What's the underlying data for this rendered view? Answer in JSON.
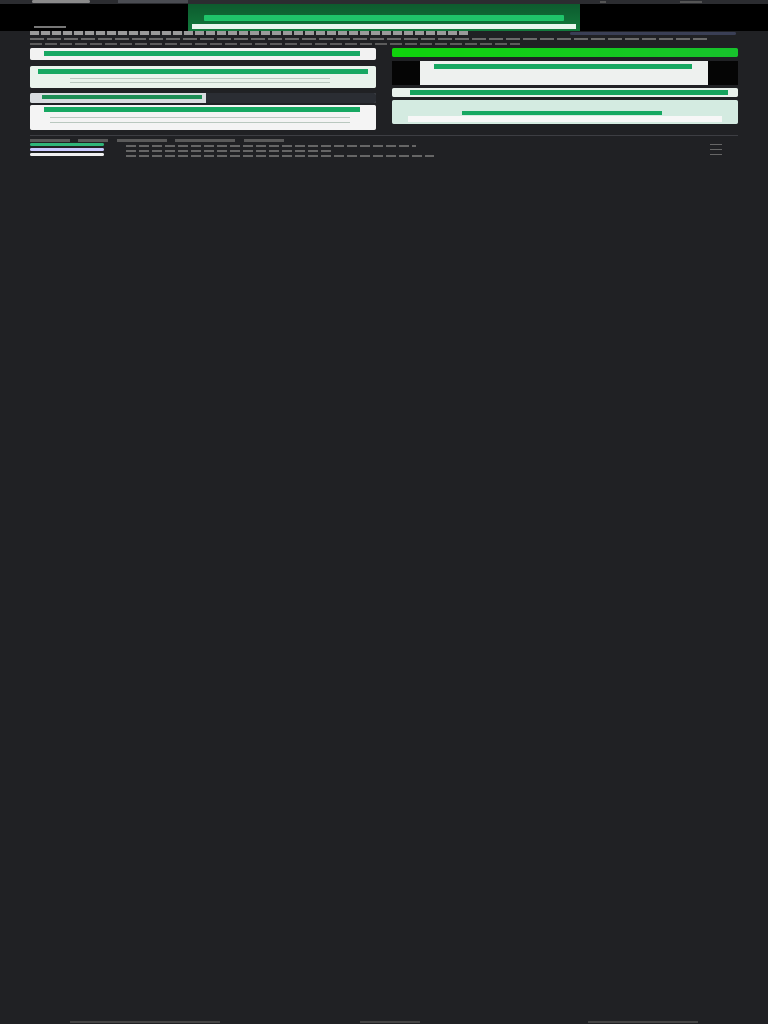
{
  "header": {
    "logo": "logo-icon",
    "brand": "",
    "nav": [
      "",
      ""
    ]
  },
  "hero": {
    "caption": ""
  },
  "article": {
    "headline": "",
    "subline": ""
  },
  "cards": [
    {
      "type": "screenshot-card"
    },
    {
      "type": "screenshot-card"
    },
    {
      "type": "screenshot-card"
    },
    {
      "type": "screenshot-card"
    }
  ],
  "right_cards": [
    {
      "type": "screenshot-card"
    },
    {
      "type": "screenshot-card"
    },
    {
      "type": "screenshot-card"
    },
    {
      "type": "screenshot-card"
    }
  ],
  "list": {
    "tabs": [
      "",
      "",
      "",
      "",
      ""
    ],
    "rows": [
      "",
      "",
      ""
    ]
  },
  "footer": [
    "",
    "",
    ""
  ],
  "colors": {
    "background": "#202124",
    "accent_green": "#17a862",
    "bright_green": "#10d40c"
  }
}
